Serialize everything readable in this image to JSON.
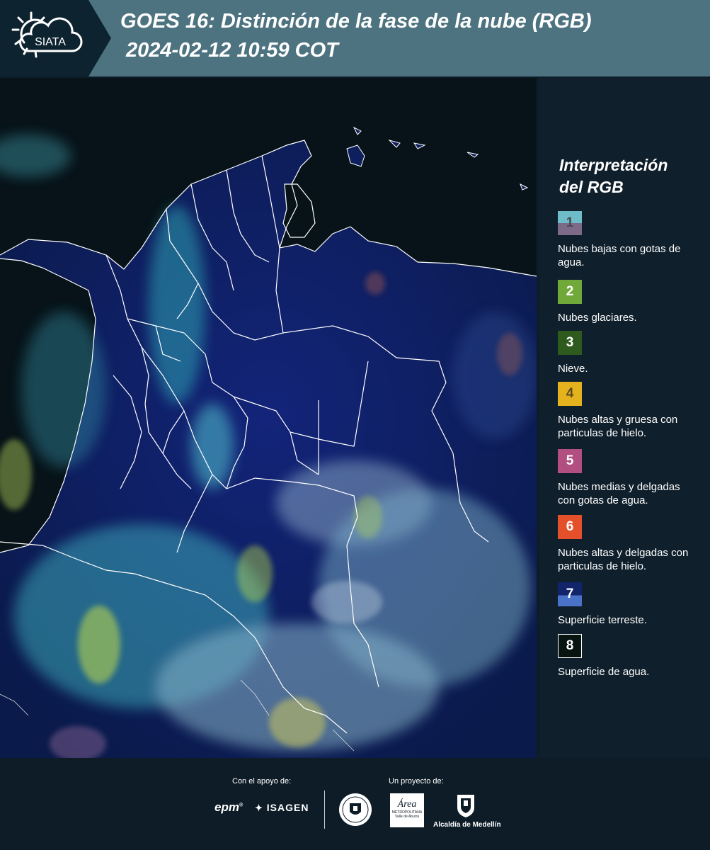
{
  "header": {
    "logo_text": "SIATA",
    "title": "GOES 16: Distinción de la fase de la nube (RGB)",
    "timestamp": "2024-02-12 10:59 COT"
  },
  "legend": {
    "title_line1": "Interpretación",
    "title_line2": "del RGB",
    "items": [
      {
        "num": "1",
        "label": "Nubes bajas con gotas de agua.",
        "color_top": "#6fbcc9",
        "color_bottom": "#7c6a88",
        "num_color": "#4a4a55"
      },
      {
        "num": "2",
        "label": "Nubes glaciares.",
        "color_top": "#70a839",
        "color_bottom": "#70a839",
        "num_color": "#ffffff"
      },
      {
        "num": "3",
        "label": "Nieve.",
        "color_top": "#2f5a1e",
        "color_bottom": "#2f5a1e",
        "num_color": "#ffffff"
      },
      {
        "num": "4",
        "label": "Nubes altas y gruesa con particulas de hielo.",
        "color_top": "#e3b21d",
        "color_bottom": "#e3b21d",
        "num_color": "#5a4a20"
      },
      {
        "num": "5",
        "label": "Nubes medias y delgadas con gotas de agua.",
        "color_top": "#b04f80",
        "color_bottom": "#b04f80",
        "num_color": "#ffffff"
      },
      {
        "num": "6",
        "label": "Nubes altas y delgadas con particulas de hielo.",
        "color_top": "#e4502a",
        "color_bottom": "#e4502a",
        "num_color": "#ffffff"
      },
      {
        "num": "7",
        "label": "Superficie terreste.",
        "color_top": "#12256a",
        "color_bottom": "#4a72c8",
        "num_color": "#ffffff"
      },
      {
        "num": "8",
        "label": "Superficie de agua.",
        "color_top": "#081410",
        "color_bottom": "#081410",
        "num_color": "#ffffff"
      }
    ]
  },
  "footer": {
    "support_label": "Con el apoyo de:",
    "project_label": "Un proyecto de:",
    "sponsor_epm": "epm",
    "sponsor_isagen": "ISAGEN",
    "partner_area": "Área",
    "partner_area_sub": "METROPOLITANA",
    "partner_area_sub2": "Valle de Aburrá",
    "partner_alcaldia": "Alcaldía de Medellín"
  },
  "colors": {
    "header_bg": "#4d7380",
    "logo_bg": "#0e2330",
    "page_bg": "#0d1d28",
    "ocean": "#071319",
    "land": "#0e1f5e",
    "cloud_cyan": "#4fd8d6",
    "cloud_yellow": "#b8d94a"
  }
}
